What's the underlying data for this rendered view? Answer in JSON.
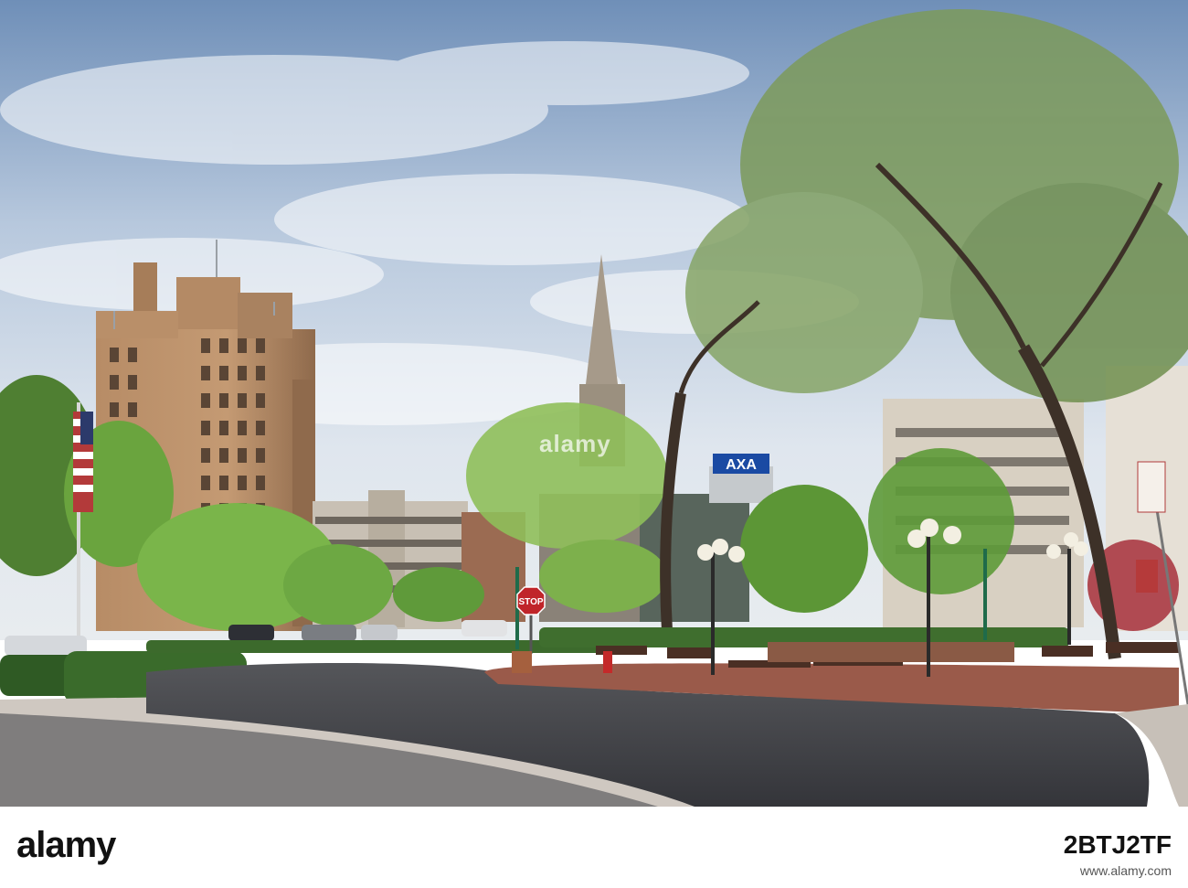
{
  "photo": {
    "signs": {
      "stop": "STOP",
      "billboard": "AXA"
    },
    "watermark": {
      "text": "alamy"
    }
  },
  "footer": {
    "logo": "alamy",
    "image_id": "2BTJ2TF",
    "site": "www.alamy.com"
  },
  "colors": {
    "sky": "#b9cbe0",
    "brick": "#b98a62",
    "foliage": "#5f9a3a",
    "road": "#3f3f42",
    "sidewalk": "#c9bfb6",
    "billboard": "#1a4aa3"
  }
}
